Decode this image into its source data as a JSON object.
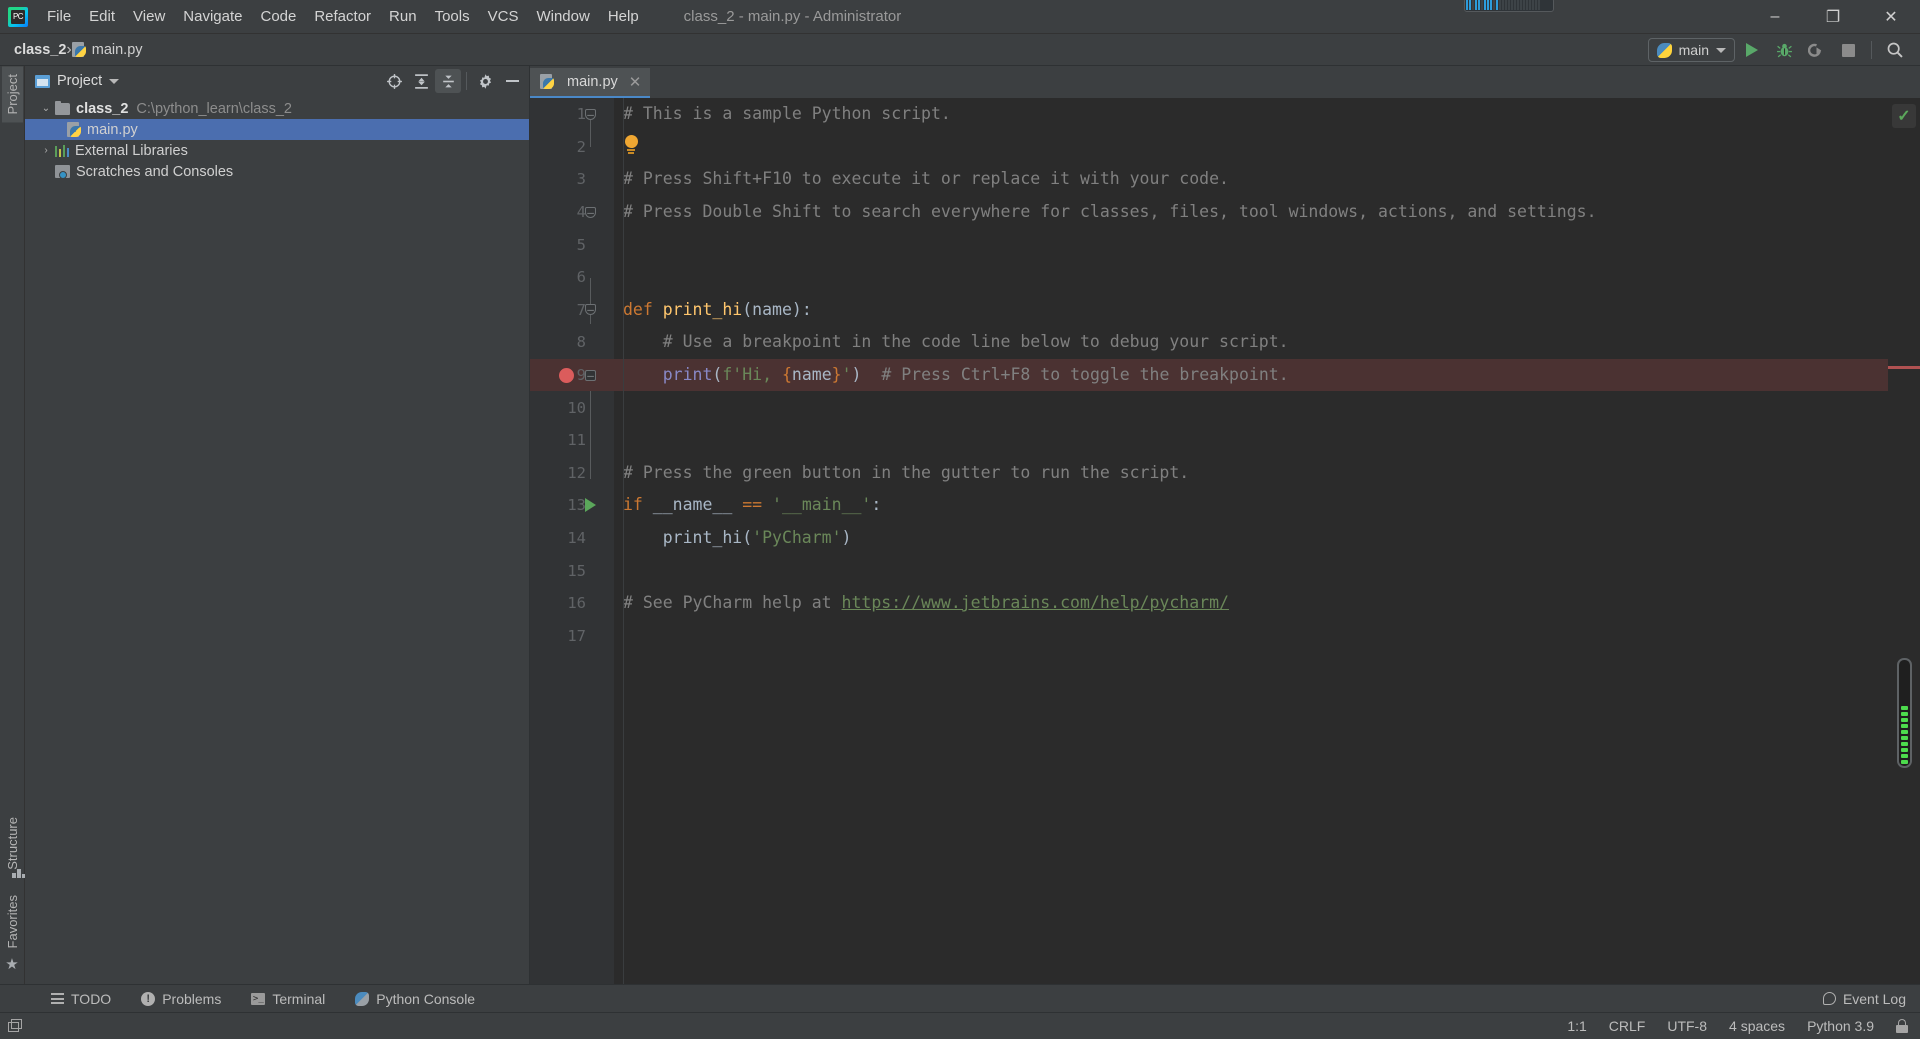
{
  "window": {
    "title": "class_2 - main.py - Administrator",
    "logo_text": "PC",
    "minimize": "–",
    "restore": "❐",
    "close": "✕"
  },
  "menubar": {
    "items": [
      {
        "label": "File",
        "mnemonic": "F"
      },
      {
        "label": "Edit",
        "mnemonic": "E"
      },
      {
        "label": "View",
        "mnemonic": "V"
      },
      {
        "label": "Navigate",
        "mnemonic": "N"
      },
      {
        "label": "Code",
        "mnemonic": "C"
      },
      {
        "label": "Refactor",
        "mnemonic": "R"
      },
      {
        "label": "Run",
        "mnemonic": "u"
      },
      {
        "label": "Tools",
        "mnemonic": "T"
      },
      {
        "label": "VCS",
        "mnemonic": ""
      },
      {
        "label": "Window",
        "mnemonic": "W"
      },
      {
        "label": "Help",
        "mnemonic": "H"
      }
    ]
  },
  "navbar": {
    "crumbs": [
      {
        "label": "class_2",
        "icon": "none"
      },
      {
        "label": "main.py",
        "icon": "python-file-icon"
      }
    ],
    "separator": "›",
    "run_config": {
      "name": "main",
      "icon": "python-icon",
      "dropdown": "chevron-down-icon"
    },
    "buttons": [
      {
        "name": "run-button",
        "icon": "play-icon"
      },
      {
        "name": "debug-button",
        "icon": "bug-icon"
      },
      {
        "name": "run-coverage-button",
        "icon": "coverage-icon"
      },
      {
        "name": "stop-button",
        "icon": "stop-icon"
      },
      {
        "name": "search-everywhere-button",
        "icon": "search-icon"
      }
    ]
  },
  "left_tool_stripe": {
    "top": [
      {
        "label": "Project",
        "icon": "project-icon",
        "selected": true
      },
      {
        "label": "",
        "icon": "folder-icon",
        "selected": false
      }
    ],
    "bottom": [
      {
        "label": "Structure",
        "icon": "structure-icon"
      },
      {
        "label": "Favorites",
        "icon": "star-icon"
      }
    ]
  },
  "project_panel": {
    "title": "Project",
    "title_dropdown": "chevron-down-icon",
    "tools": [
      {
        "name": "locate-icon"
      },
      {
        "name": "expand-all-icon"
      },
      {
        "name": "collapse-all-icon"
      },
      {
        "name": "settings-gear-icon"
      },
      {
        "name": "hide-icon"
      }
    ],
    "tree": [
      {
        "label": "class_2",
        "path": "C:\\python_learn\\class_2",
        "icon": "folder-icon",
        "arrow": "⌄",
        "expanded": true,
        "depth": 0,
        "selected": false,
        "bold": true
      },
      {
        "label": "main.py",
        "path": "",
        "icon": "python-file-icon",
        "arrow": "",
        "expanded": false,
        "depth": 1,
        "selected": true,
        "bold": false
      },
      {
        "label": "External Libraries",
        "path": "",
        "icon": "libraries-icon",
        "arrow": "›",
        "expanded": false,
        "depth": 0,
        "selected": false,
        "bold": false
      },
      {
        "label": "Scratches and Consoles",
        "path": "",
        "icon": "scratches-icon",
        "arrow": "",
        "expanded": false,
        "depth": 0,
        "selected": false,
        "bold": false
      }
    ]
  },
  "editor": {
    "tabs": [
      {
        "label": "main.py",
        "icon": "python-file-icon",
        "close": "✕",
        "active": true
      }
    ],
    "inspection_status": "✓",
    "line_count": 17,
    "lines": [
      {
        "n": 1,
        "fold": "open",
        "gutter": "",
        "text": "# This is a sample Python script.",
        "kind": "comment"
      },
      {
        "n": 2,
        "fold": "",
        "gutter": "",
        "text": "",
        "kind": "blank"
      },
      {
        "n": 3,
        "fold": "",
        "gutter": "",
        "text": "# Press Shift+F10 to execute it or replace it with your code.",
        "kind": "comment"
      },
      {
        "n": 4,
        "fold": "open",
        "gutter": "",
        "text": "# Press Double Shift to search everywhere for classes, files, tool windows, actions, and settings.",
        "kind": "comment"
      },
      {
        "n": 5,
        "fold": "",
        "gutter": "",
        "text": "",
        "kind": "blank"
      },
      {
        "n": 6,
        "fold": "",
        "gutter": "",
        "text": "",
        "kind": "blank"
      },
      {
        "n": 7,
        "fold": "open",
        "gutter": "",
        "text": "def print_hi(name):",
        "kind": "def"
      },
      {
        "n": 8,
        "fold": "",
        "gutter": "",
        "text": "    # Use a breakpoint in the code line below to debug your script.",
        "kind": "comment"
      },
      {
        "n": 9,
        "fold": "closed",
        "gutter": "breakpoint",
        "text": "    print(f'Hi, {name}')  # Press Ctrl+F8 to toggle the breakpoint.",
        "kind": "print"
      },
      {
        "n": 10,
        "fold": "",
        "gutter": "",
        "text": "",
        "kind": "blank"
      },
      {
        "n": 11,
        "fold": "",
        "gutter": "",
        "text": "",
        "kind": "blank"
      },
      {
        "n": 12,
        "fold": "",
        "gutter": "",
        "text": "# Press the green button in the gutter to run the script.",
        "kind": "comment"
      },
      {
        "n": 13,
        "fold": "",
        "gutter": "run",
        "text": "if __name__ == '__main__':",
        "kind": "if"
      },
      {
        "n": 14,
        "fold": "",
        "gutter": "",
        "text": "    print_hi('PyCharm')",
        "kind": "call"
      },
      {
        "n": 15,
        "fold": "",
        "gutter": "",
        "text": "",
        "kind": "blank"
      },
      {
        "n": 16,
        "fold": "",
        "gutter": "",
        "text": "# See PyCharm help at https://www.jetbrains.com/help/pycharm/",
        "kind": "link"
      },
      {
        "n": 17,
        "fold": "",
        "gutter": "",
        "text": "",
        "kind": "blank"
      }
    ],
    "intention_bulb": "lightbulb-icon"
  },
  "bottom_tool_tabs": [
    {
      "label": "TODO",
      "icon": "todo-icon"
    },
    {
      "label": "Problems",
      "icon": "problems-icon"
    },
    {
      "label": "Terminal",
      "icon": "terminal-icon"
    },
    {
      "label": "Python Console",
      "icon": "python-console-icon"
    }
  ],
  "event_log": {
    "label": "Event Log",
    "icon": "event-log-icon"
  },
  "statusbar": {
    "caret_position": "1:1",
    "line_separator": "CRLF",
    "encoding": "UTF-8",
    "indent": "4 spaces",
    "interpreter": "Python 3.9",
    "lock": "lock-icon"
  },
  "colors": {
    "accent_blue": "#4b6eaf",
    "bg_chrome": "#3c3f41",
    "bg_editor": "#2b2b2b",
    "gutter": "#313335",
    "comment": "#808080",
    "keyword": "#cc7832",
    "function": "#ffc66d",
    "string": "#6a8759",
    "breakpoint_red": "#db5c5c",
    "run_green": "#59a869",
    "text": "#a9b7c6"
  }
}
